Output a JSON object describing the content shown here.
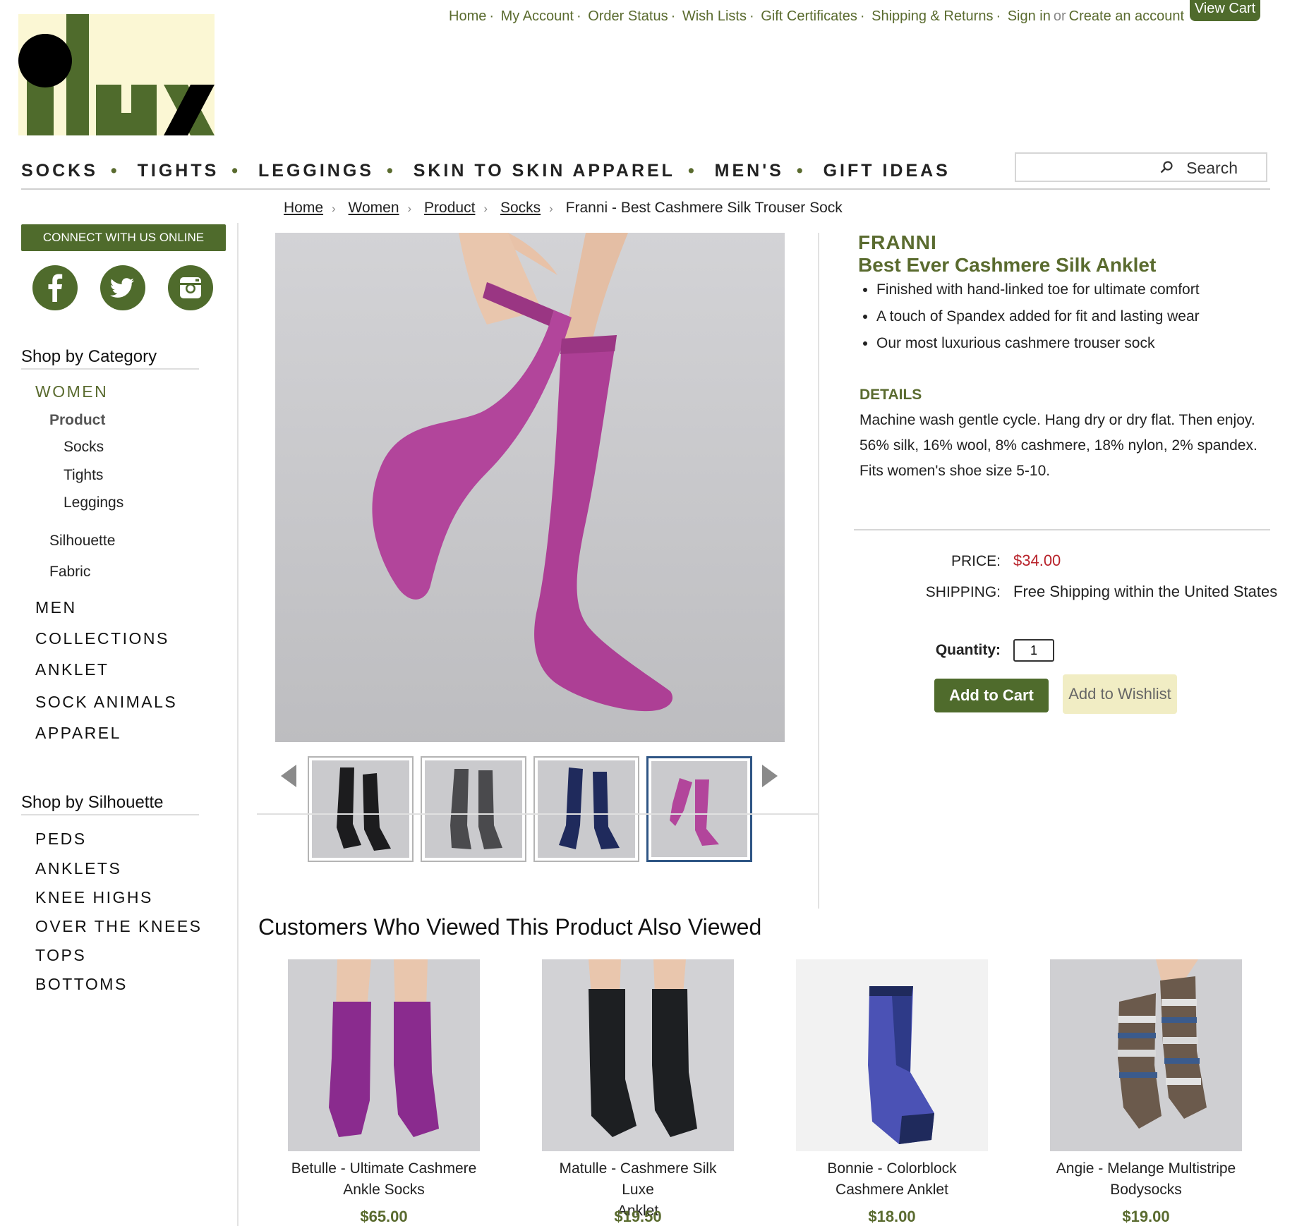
{
  "header": {
    "utility_links": [
      "Home",
      "My Account",
      "Order Status",
      "Wish Lists",
      "Gift Certificates",
      "Shipping & Returns",
      "Sign in"
    ],
    "or_text": "or",
    "create_account": "Create an account",
    "view_cart": "View Cart",
    "logo_text": "ilux"
  },
  "main_nav": [
    "SOCKS",
    "TIGHTS",
    "LEGGINGS",
    "SKIN TO SKIN APPAREL",
    "MEN'S",
    "GIFT IDEAS"
  ],
  "search": {
    "label": "Search",
    "placeholder": ""
  },
  "breadcrumb": {
    "links": [
      "Home",
      "Women",
      "Product",
      "Socks"
    ],
    "current": "Franni - Best Cashmere Silk Trouser Sock"
  },
  "sidebar": {
    "connect_label": "CONNECT WITH US ONLINE",
    "social": [
      "facebook-icon",
      "twitter-icon",
      "instagram-icon"
    ],
    "shop_by_category": "Shop by Category",
    "women": "WOMEN",
    "product": "Product",
    "product_items": [
      "Socks",
      "Tights",
      "Leggings"
    ],
    "silhouette": "Silhouette",
    "fabric": "Fabric",
    "categories": [
      "MEN",
      "COLLECTIONS",
      "ANKLET",
      "SOCK ANIMALS",
      "APPAREL"
    ],
    "shop_by_silhouette": "Shop by Silhouette",
    "silhouettes": [
      "PEDS",
      "ANKLETS",
      "KNEE HIGHS",
      "OVER THE KNEES",
      "TOPS",
      "BOTTOMS"
    ]
  },
  "product": {
    "brand": "FRANNI",
    "name": "Best Ever Cashmere Silk Anklet",
    "features": [
      "Finished with hand-linked toe for ultimate comfort",
      "A touch of Spandex added for fit and lasting wear",
      "Our most luxurious cashmere trouser sock"
    ],
    "details_heading": "DETAILS",
    "details": [
      "Machine wash gentle cycle. Hang dry or dry flat. Then enjoy.",
      "56% silk, 16% wool, 8% cashmere, 18% nylon, 2% spandex.",
      "Fits women's shoe size 5-10."
    ],
    "price_label": "PRICE:",
    "price": "$34.00",
    "shipping_label": "SHIPPING:",
    "shipping": "Free Shipping within the United States",
    "quantity_label": "Quantity:",
    "quantity": "1",
    "add_to_cart": "Add to Cart",
    "add_to_wishlist": "Add to Wishlist",
    "thumb_colors": [
      "#1c1c1e",
      "#4a4a4d",
      "#1f2a5c",
      "#b2459b"
    ],
    "hero_color": "#b2459b"
  },
  "related": {
    "heading": "Customers Who Viewed This Product Also Viewed",
    "items": [
      {
        "title_1": "Betulle - Ultimate Cashmere",
        "title_2": "Ankle Socks",
        "price": "$65.00",
        "color": "#8a2b8e"
      },
      {
        "title_1": "Matulle - Cashmere Silk Luxe",
        "title_2": "Anklet",
        "price": "$19.50",
        "color": "#1d1f22"
      },
      {
        "title_1": "Bonnie - Colorblock",
        "title_2": "Cashmere Anklet",
        "price": "$18.00",
        "color": "#4b52b5"
      },
      {
        "title_1": "Angie - Melange Multistripe",
        "title_2": "Bodysocks",
        "price": "$19.00",
        "color": "#6b5a4c"
      }
    ]
  },
  "colors": {
    "brand_green": "#4f6b2c",
    "text_green": "#5a6b2f",
    "price_red": "#b8232b"
  }
}
